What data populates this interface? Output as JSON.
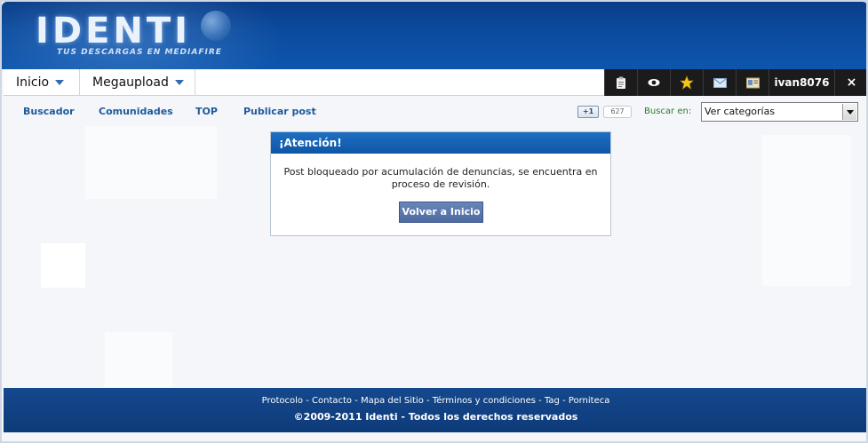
{
  "header": {
    "logo_text": "IDENTI",
    "tagline": "TUS DESCARGAS EN MEDIAFIRE"
  },
  "menu": {
    "items": [
      {
        "label": "Inicio"
      },
      {
        "label": "Megaupload"
      }
    ]
  },
  "userbar": {
    "username": "ivan8076",
    "icons": [
      "clipboard-icon",
      "eye-icon",
      "star-icon",
      "mail-icon",
      "profile-card-icon"
    ],
    "close_label": "×"
  },
  "subnav": {
    "links": [
      "Buscador",
      "Comunidades",
      "TOP",
      "Publicar post"
    ],
    "gplus_label": "+1",
    "gplus_count": "627",
    "search_label": "Buscar en:",
    "category_selected": "Ver categorías"
  },
  "alert": {
    "title": "¡Atención!",
    "message": "Post bloqueado por acumulación de denuncias, se encuentra en proceso de revisión.",
    "button_label": "Volver a Inicio"
  },
  "footer": {
    "links": [
      "Protocolo",
      "Contacto",
      "Mapa del Sitio",
      "Términos y condiciones",
      "Tag",
      "Porniteca"
    ],
    "separator": " - ",
    "copyright": "©2009-2011 Identi - Todos los derechos reservados"
  },
  "colors": {
    "header_blue": "#0b4a9c",
    "link_blue": "#1e5a9c",
    "userbar_black": "#1b1b1b",
    "search_label_green": "#2a7a2a",
    "button_blue": "#5874a9"
  }
}
